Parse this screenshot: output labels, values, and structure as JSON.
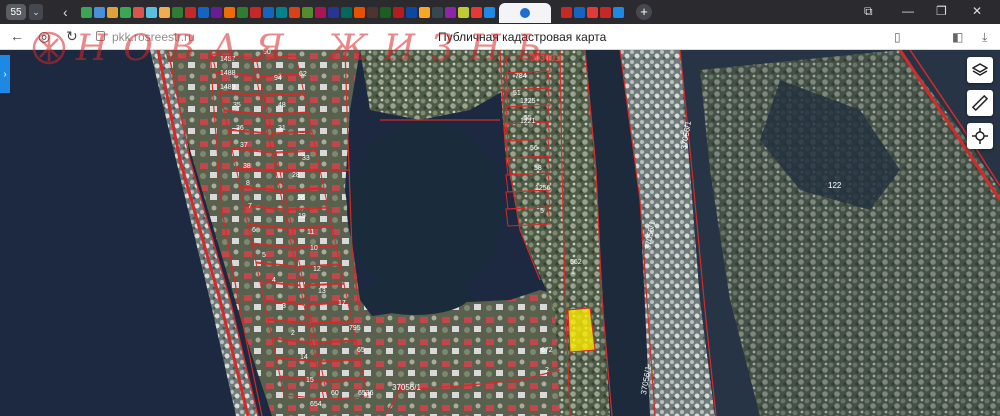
{
  "browser": {
    "tab_counter": "55",
    "colors": {
      "tabbar": "#2b2b2f",
      "active_tab": "#f4f4f6"
    }
  },
  "address_bar": {
    "url": "pkk.rosreestr.ru",
    "page_title": "Публичная кадастровая карта"
  },
  "watermark": {
    "text": "НОВАЯ ЖИЗНЬ",
    "color": "#d8272a"
  },
  "map": {
    "colors": {
      "boundary": "#d42a2a",
      "highlight": "#ffee00",
      "water": "#1c2940"
    },
    "plot_labels": [
      "1487",
      "1488",
      "1489",
      "35",
      "36",
      "37",
      "38",
      "8",
      "7",
      "6",
      "5",
      "4",
      "3",
      "2",
      "14",
      "15",
      "654",
      "103",
      "90",
      "94",
      "62",
      "48",
      "31",
      "33",
      "28",
      "26",
      "19",
      "11",
      "10",
      "12",
      "13",
      "17",
      "795",
      "65",
      "60",
      "6536",
      "784",
      "51",
      "1225",
      "1221",
      "55",
      "56",
      "58",
      "1256",
      "5",
      "562",
      "672",
      "2",
      "1"
    ],
    "area_labels": [
      "303001",
      "37056/1",
      "37056/1",
      "37056/1",
      "122",
      "37056/1"
    ]
  },
  "tools": {
    "layers_icon": "layers-icon",
    "ruler_icon": "ruler-icon",
    "locate_icon": "crosshair-icon"
  }
}
